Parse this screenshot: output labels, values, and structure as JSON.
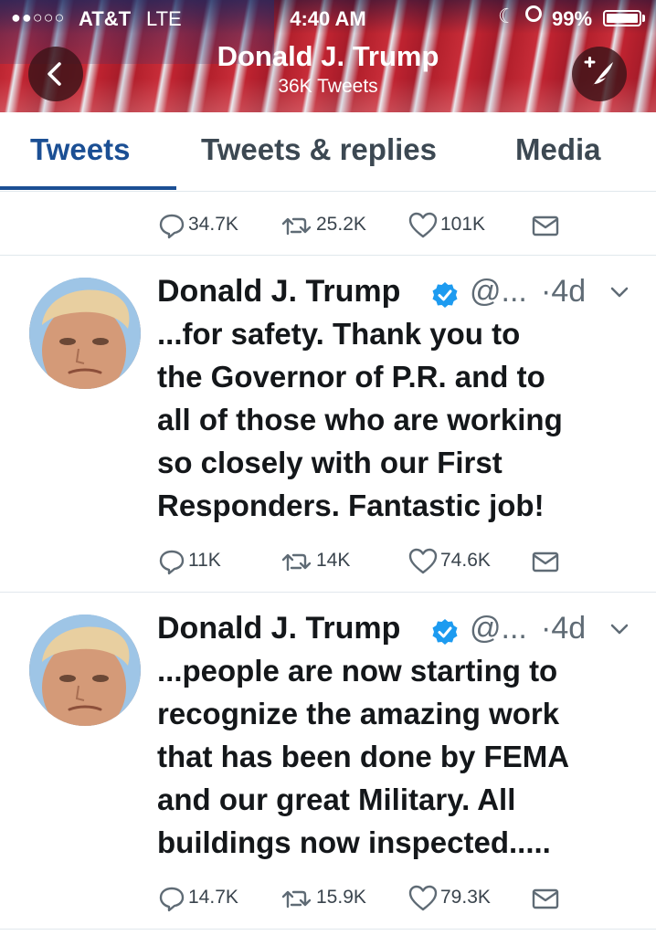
{
  "status_bar": {
    "signal": "●●○○○",
    "carrier": "AT&T",
    "network": "LTE",
    "time": "4:40 AM",
    "battery": "99%",
    "battery_level": 0.99
  },
  "header": {
    "name": "Donald J. Trump",
    "tweet_count": "36K Tweets"
  },
  "tabs": [
    {
      "label": "Tweets",
      "active": true
    },
    {
      "label": "Tweets & replies",
      "active": false
    },
    {
      "label": "Media",
      "active": false
    }
  ],
  "top_actions": {
    "replies": "34.7K",
    "retweets": "25.2K",
    "likes": "101K"
  },
  "tweets": [
    {
      "name": "Donald J. Trump",
      "handle": "@...",
      "time": "·4d",
      "text": "...for safety. Thank you to\nthe Governor of P.R. and to\nall of those who are working\nso closely with our First\nResponders. Fantastic job!",
      "replies": "11K",
      "retweets": "14K",
      "likes": "74.6K"
    },
    {
      "name": "Donald J. Trump",
      "handle": "@...",
      "time": "·4d",
      "text": "...people are now starting to\nrecognize the amazing work\nthat has been done by FEMA\nand our great Military. All\nbuildings now inspected.....",
      "replies": "14.7K",
      "retweets": "15.9K",
      "likes": "79.3K"
    }
  ],
  "colors": {
    "accent": "#1b4f94",
    "verified": "#1d9bf0",
    "muted": "#5f6b75"
  }
}
